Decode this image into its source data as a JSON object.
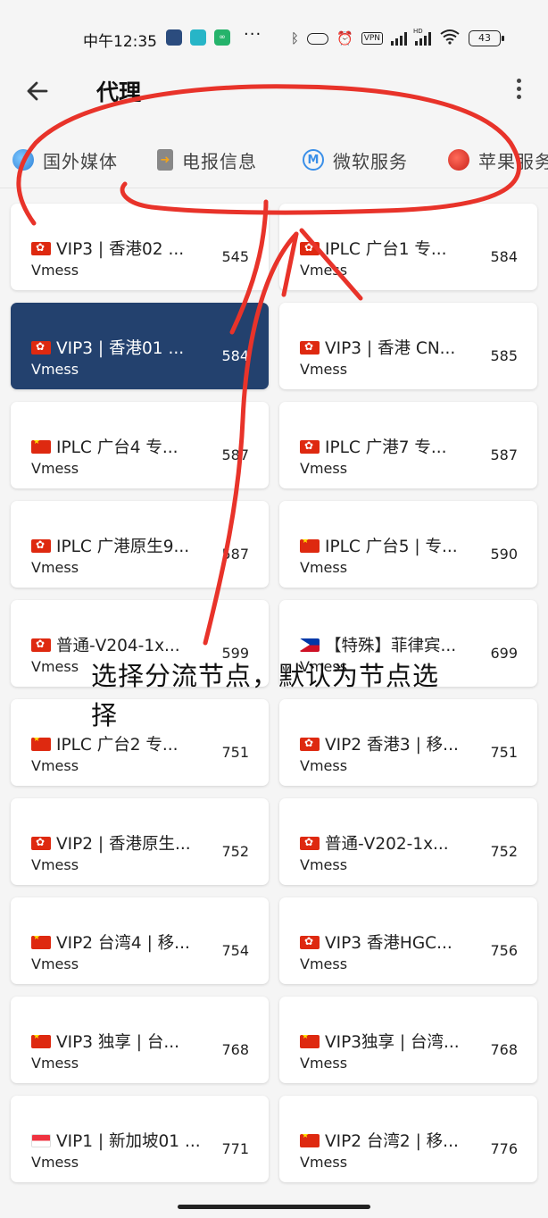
{
  "status_bar": {
    "time": "中午12:35",
    "dots": "···",
    "vpn": "VPN",
    "hd": "HD",
    "battery": "43"
  },
  "header": {
    "title": "代理"
  },
  "tabs": [
    {
      "label": "国外媒体",
      "icon": "globe-icon"
    },
    {
      "label": "电报信息",
      "icon": "phone-icon"
    },
    {
      "label": "微软服务",
      "icon": "m-icon",
      "glyph": "M"
    },
    {
      "label": "苹果服务",
      "icon": "apple-icon"
    }
  ],
  "proxies": [
    {
      "flag": "hk",
      "name": "VIP3 | 香港02 ...",
      "type": "Vmess",
      "delay": "545"
    },
    {
      "flag": "hk",
      "name": "IPLC 广台1 专...",
      "type": "Vmess",
      "delay": "584"
    },
    {
      "flag": "hk",
      "name": "VIP3 | 香港01 ...",
      "type": "Vmess",
      "delay": "584",
      "selected": true
    },
    {
      "flag": "hk",
      "name": "VIP3 | 香港 CN...",
      "type": "Vmess",
      "delay": "585"
    },
    {
      "flag": "cn",
      "name": "IPLC 广台4 专...",
      "type": "Vmess",
      "delay": "587"
    },
    {
      "flag": "hk",
      "name": "IPLC 广港7 专...",
      "type": "Vmess",
      "delay": "587"
    },
    {
      "flag": "hk",
      "name": "IPLC 广港原生9...",
      "type": "Vmess",
      "delay": "587"
    },
    {
      "flag": "cn",
      "name": "IPLC 广台5 | 专...",
      "type": "Vmess",
      "delay": "590"
    },
    {
      "flag": "hk",
      "name": "普通-V204-1x...",
      "type": "Vmess",
      "delay": "599"
    },
    {
      "flag": "ph",
      "name": "【特殊】菲律宾...",
      "type": "Vmess",
      "delay": "699"
    },
    {
      "flag": "cn",
      "name": "IPLC 广台2 专...",
      "type": "Vmess",
      "delay": "751"
    },
    {
      "flag": "hk",
      "name": "VIP2 香港3 | 移...",
      "type": "Vmess",
      "delay": "751"
    },
    {
      "flag": "hk",
      "name": "VIP2 | 香港原生...",
      "type": "Vmess",
      "delay": "752"
    },
    {
      "flag": "hk",
      "name": "普通-V202-1x...",
      "type": "Vmess",
      "delay": "752"
    },
    {
      "flag": "cn",
      "name": "VIP2 台湾4 | 移...",
      "type": "Vmess",
      "delay": "754"
    },
    {
      "flag": "hk",
      "name": "VIP3 香港HGC...",
      "type": "Vmess",
      "delay": "756"
    },
    {
      "flag": "cn",
      "name": "VIP3 独享 | 台...",
      "type": "Vmess",
      "delay": "768"
    },
    {
      "flag": "cn",
      "name": "VIP3独享 | 台湾...",
      "type": "Vmess",
      "delay": "768"
    },
    {
      "flag": "sg",
      "name": "VIP1 | 新加坡01 ...",
      "type": "Vmess",
      "delay": "771"
    },
    {
      "flag": "cn",
      "name": "VIP2 台湾2 | 移...",
      "type": "Vmess",
      "delay": "776"
    }
  ],
  "annotation": {
    "text": "选择分流节点，默认为节点选择",
    "color": "#e8332a"
  },
  "colors": {
    "selected_card": "#23416e",
    "background": "#f5f5f5"
  }
}
